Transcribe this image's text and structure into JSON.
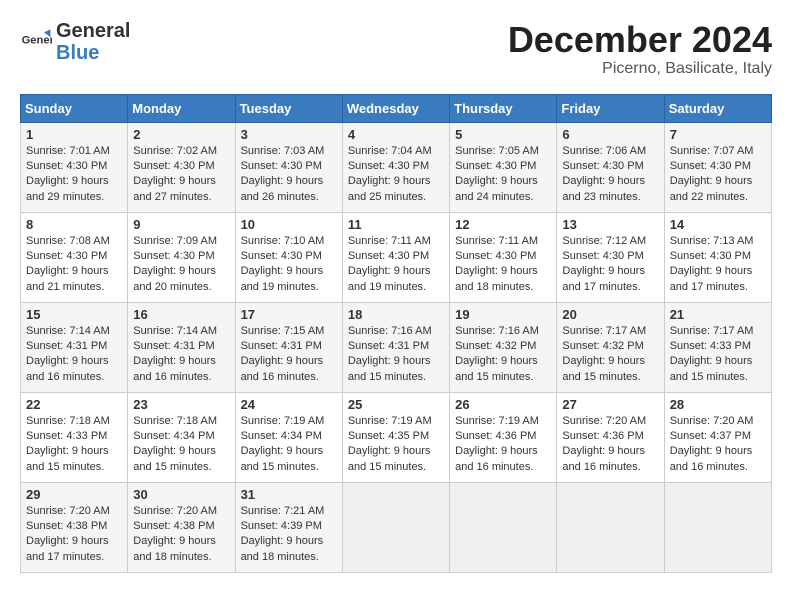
{
  "header": {
    "logo_general": "General",
    "logo_blue": "Blue",
    "month_title": "December 2024",
    "location": "Picerno, Basilicate, Italy"
  },
  "days_of_week": [
    "Sunday",
    "Monday",
    "Tuesday",
    "Wednesday",
    "Thursday",
    "Friday",
    "Saturday"
  ],
  "weeks": [
    [
      {
        "day": "1",
        "sunrise": "7:01 AM",
        "sunset": "4:30 PM",
        "daylight": "9 hours and 29 minutes."
      },
      {
        "day": "2",
        "sunrise": "7:02 AM",
        "sunset": "4:30 PM",
        "daylight": "9 hours and 27 minutes."
      },
      {
        "day": "3",
        "sunrise": "7:03 AM",
        "sunset": "4:30 PM",
        "daylight": "9 hours and 26 minutes."
      },
      {
        "day": "4",
        "sunrise": "7:04 AM",
        "sunset": "4:30 PM",
        "daylight": "9 hours and 25 minutes."
      },
      {
        "day": "5",
        "sunrise": "7:05 AM",
        "sunset": "4:30 PM",
        "daylight": "9 hours and 24 minutes."
      },
      {
        "day": "6",
        "sunrise": "7:06 AM",
        "sunset": "4:30 PM",
        "daylight": "9 hours and 23 minutes."
      },
      {
        "day": "7",
        "sunrise": "7:07 AM",
        "sunset": "4:30 PM",
        "daylight": "9 hours and 22 minutes."
      }
    ],
    [
      {
        "day": "8",
        "sunrise": "7:08 AM",
        "sunset": "4:30 PM",
        "daylight": "9 hours and 21 minutes."
      },
      {
        "day": "9",
        "sunrise": "7:09 AM",
        "sunset": "4:30 PM",
        "daylight": "9 hours and 20 minutes."
      },
      {
        "day": "10",
        "sunrise": "7:10 AM",
        "sunset": "4:30 PM",
        "daylight": "9 hours and 19 minutes."
      },
      {
        "day": "11",
        "sunrise": "7:11 AM",
        "sunset": "4:30 PM",
        "daylight": "9 hours and 19 minutes."
      },
      {
        "day": "12",
        "sunrise": "7:11 AM",
        "sunset": "4:30 PM",
        "daylight": "9 hours and 18 minutes."
      },
      {
        "day": "13",
        "sunrise": "7:12 AM",
        "sunset": "4:30 PM",
        "daylight": "9 hours and 17 minutes."
      },
      {
        "day": "14",
        "sunrise": "7:13 AM",
        "sunset": "4:30 PM",
        "daylight": "9 hours and 17 minutes."
      }
    ],
    [
      {
        "day": "15",
        "sunrise": "7:14 AM",
        "sunset": "4:31 PM",
        "daylight": "9 hours and 16 minutes."
      },
      {
        "day": "16",
        "sunrise": "7:14 AM",
        "sunset": "4:31 PM",
        "daylight": "9 hours and 16 minutes."
      },
      {
        "day": "17",
        "sunrise": "7:15 AM",
        "sunset": "4:31 PM",
        "daylight": "9 hours and 16 minutes."
      },
      {
        "day": "18",
        "sunrise": "7:16 AM",
        "sunset": "4:31 PM",
        "daylight": "9 hours and 15 minutes."
      },
      {
        "day": "19",
        "sunrise": "7:16 AM",
        "sunset": "4:32 PM",
        "daylight": "9 hours and 15 minutes."
      },
      {
        "day": "20",
        "sunrise": "7:17 AM",
        "sunset": "4:32 PM",
        "daylight": "9 hours and 15 minutes."
      },
      {
        "day": "21",
        "sunrise": "7:17 AM",
        "sunset": "4:33 PM",
        "daylight": "9 hours and 15 minutes."
      }
    ],
    [
      {
        "day": "22",
        "sunrise": "7:18 AM",
        "sunset": "4:33 PM",
        "daylight": "9 hours and 15 minutes."
      },
      {
        "day": "23",
        "sunrise": "7:18 AM",
        "sunset": "4:34 PM",
        "daylight": "9 hours and 15 minutes."
      },
      {
        "day": "24",
        "sunrise": "7:19 AM",
        "sunset": "4:34 PM",
        "daylight": "9 hours and 15 minutes."
      },
      {
        "day": "25",
        "sunrise": "7:19 AM",
        "sunset": "4:35 PM",
        "daylight": "9 hours and 15 minutes."
      },
      {
        "day": "26",
        "sunrise": "7:19 AM",
        "sunset": "4:36 PM",
        "daylight": "9 hours and 16 minutes."
      },
      {
        "day": "27",
        "sunrise": "7:20 AM",
        "sunset": "4:36 PM",
        "daylight": "9 hours and 16 minutes."
      },
      {
        "day": "28",
        "sunrise": "7:20 AM",
        "sunset": "4:37 PM",
        "daylight": "9 hours and 16 minutes."
      }
    ],
    [
      {
        "day": "29",
        "sunrise": "7:20 AM",
        "sunset": "4:38 PM",
        "daylight": "9 hours and 17 minutes."
      },
      {
        "day": "30",
        "sunrise": "7:20 AM",
        "sunset": "4:38 PM",
        "daylight": "9 hours and 18 minutes."
      },
      {
        "day": "31",
        "sunrise": "7:21 AM",
        "sunset": "4:39 PM",
        "daylight": "9 hours and 18 minutes."
      },
      null,
      null,
      null,
      null
    ]
  ]
}
